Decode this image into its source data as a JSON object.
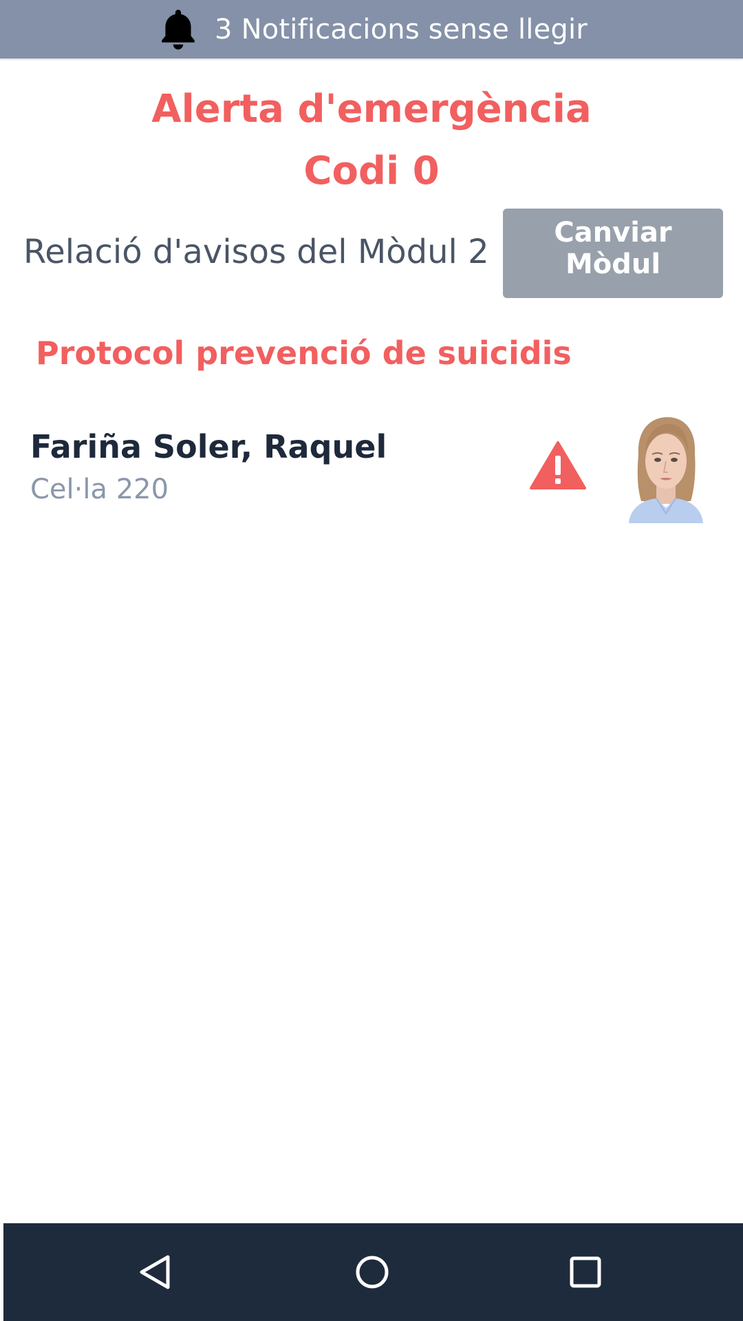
{
  "notifications": {
    "text": "3 Notificacions sense llegir",
    "icon": "bell-icon"
  },
  "alert": {
    "title": "Alerta d'emergència",
    "code": "Codi 0",
    "color": "#f25f5f"
  },
  "module": {
    "label": "Relació d'avisos del Mòdul 2",
    "change_button": "Canviar Mòdul"
  },
  "protocol": {
    "title": "Protocol prevenció de suicidis"
  },
  "patients": [
    {
      "name": "Fariña Soler, Raquel",
      "cell": "Cel·la 220",
      "status_icon": "warning-icon",
      "photo": "avatar"
    }
  ],
  "nav": {
    "back_icon": "back-icon",
    "home_icon": "home-icon",
    "recents_icon": "recents-icon"
  },
  "colors": {
    "notification_bar": "#8491a8",
    "button": "#98a0ab",
    "nav_bar": "#1e2b3c",
    "alert": "#f25f5f"
  }
}
